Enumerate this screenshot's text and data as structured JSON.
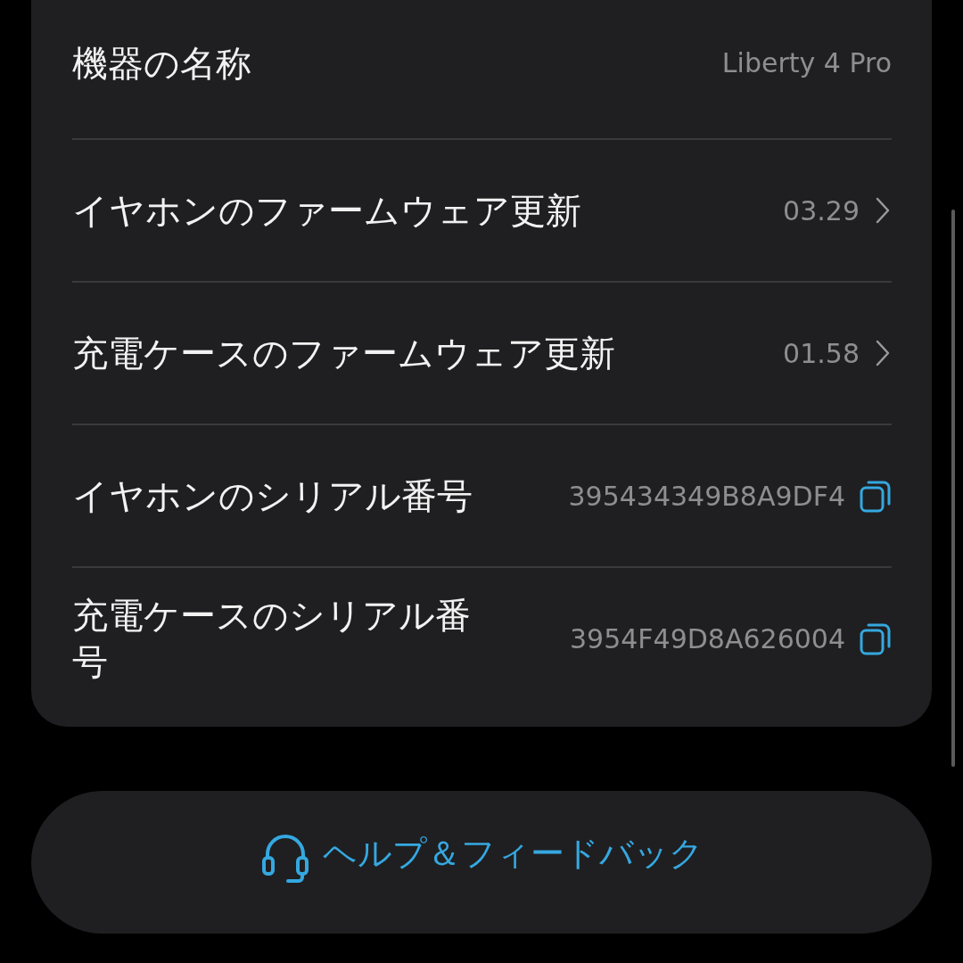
{
  "settings": {
    "rows": [
      {
        "kind": "text",
        "label": "機器の名称",
        "value": "Liberty 4 Pro"
      },
      {
        "kind": "link",
        "label": "イヤホンのファームウェア更新",
        "value": "03.29"
      },
      {
        "kind": "link",
        "label": "充電ケースのファームウェア更新",
        "value": "01.58"
      },
      {
        "kind": "copy",
        "label": "イヤホンのシリアル番号",
        "value": "395434349B8A9DF4"
      },
      {
        "kind": "copy",
        "label": "充電ケースのシリアル番号",
        "value": "3954F49D8A626004"
      }
    ]
  },
  "help_button": {
    "label": "ヘルプ＆フィードバック"
  }
}
